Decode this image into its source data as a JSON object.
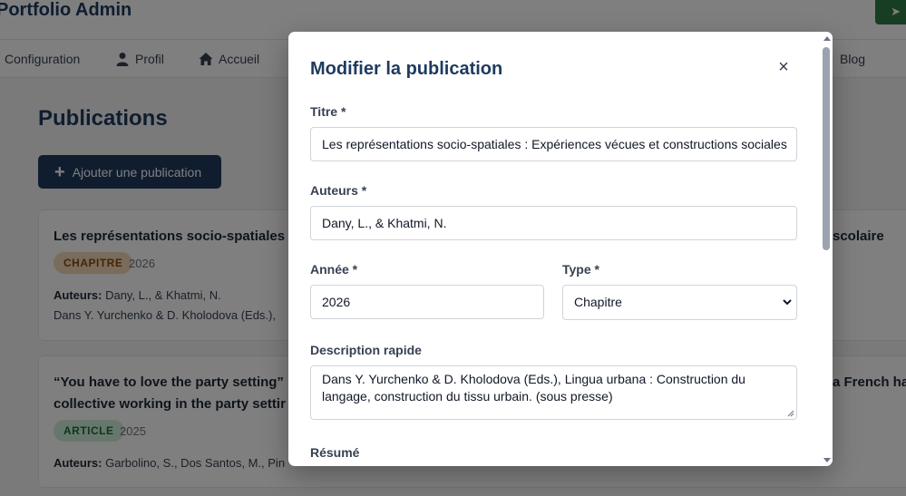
{
  "app": {
    "brand": "Portfolio Admin"
  },
  "nav": {
    "items": [
      {
        "label": "Configuration"
      },
      {
        "label": "Profil"
      },
      {
        "label": "Accueil"
      },
      {
        "label": "Blog"
      }
    ]
  },
  "page": {
    "title": "Publications",
    "add_button": "Ajouter une publication"
  },
  "cards": [
    {
      "title": "Les représentations socio-spatiales :",
      "title_tail": "scolaire",
      "badge": "CHAPITRE",
      "year": "2026",
      "authors_label": "Auteurs:",
      "authors": "Dany, L., & Khatmi, N.",
      "description": "Dans Y. Yurchenko & D. Kholodova (Eds.),"
    },
    {
      "title_line1": "“You have to love the party setting”",
      "title_line2": "collective working in the party settir",
      "title_tail": "a French ha",
      "badge": "ARTICLE",
      "year": "2025",
      "authors_label": "Auteurs:",
      "authors": "Garbolino, S., Dos Santos, M., Pin"
    }
  ],
  "modal": {
    "title": "Modifier la publication",
    "close": "×",
    "fields": {
      "titre_label": "Titre *",
      "titre_value": "Les représentations socio-spatiales : Expériences vécues et constructions sociales",
      "auteurs_label": "Auteurs *",
      "auteurs_value": "Dany, L., & Khatmi, N.",
      "annee_label": "Année *",
      "annee_value": "2026",
      "type_label": "Type *",
      "type_value": "Chapitre",
      "description_label": "Description rapide",
      "description_value": " Dans Y. Yurchenko & D. Kholodova (Eds.), Lingua urbana : Construction du langage, construction du tissu urbain. (sous presse)",
      "resume_label": "Résumé"
    }
  },
  "colors": {
    "primary": "#1e3a5f",
    "chapitre_badge": "#f3d9b8",
    "article_badge": "#d1eedb",
    "accent_green": "#2e7d46"
  }
}
